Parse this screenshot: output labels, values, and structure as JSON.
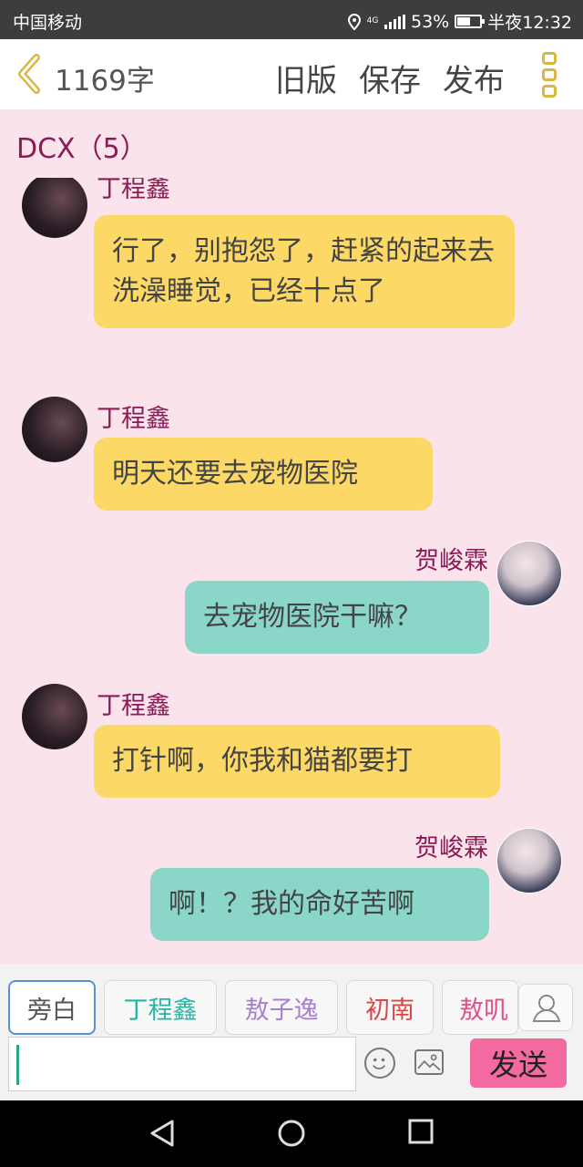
{
  "status_bar": {
    "carrier": "中国移动",
    "network": "4G",
    "battery": "53%",
    "time": "半夜12:32"
  },
  "header": {
    "word_count": "1169字",
    "old_version": "旧版",
    "save": "保存",
    "publish": "发布"
  },
  "conversation": {
    "title": "DCX（5）"
  },
  "messages": [
    {
      "side": "left",
      "sender": "丁程鑫",
      "text": "行了，别抱怨了，赶紧的起来去洗澡睡觉，已经十点了"
    },
    {
      "side": "left",
      "sender": "丁程鑫",
      "text": "明天还要去宠物医院"
    },
    {
      "side": "right",
      "sender": "贺峻霖",
      "text": "去宠物医院干嘛？"
    },
    {
      "side": "left",
      "sender": "丁程鑫",
      "text": "打针啊，你我和猫都要打"
    },
    {
      "side": "right",
      "sender": "贺峻霖",
      "text": "啊！？我的命好苦啊"
    }
  ],
  "roles": [
    {
      "label": "旁白",
      "color": "#555555",
      "selected": true
    },
    {
      "label": "丁程鑫",
      "color": "#2bb3a3",
      "selected": false
    },
    {
      "label": "敖子逸",
      "color": "#a77fd0",
      "selected": false
    },
    {
      "label": "初南",
      "color": "#d8484a",
      "selected": false
    },
    {
      "label": "敖叽",
      "color": "#e0508a",
      "selected": false
    }
  ],
  "input": {
    "value": "",
    "placeholder": ""
  },
  "send_label": "发送",
  "colors": {
    "header_accent": "#d8b743",
    "name_color": "#8a1b55",
    "left_bubble": "#fcd966",
    "right_bubble": "#8ad7c9",
    "send_button": "#f36aa0",
    "background": "#fbe3ec"
  }
}
